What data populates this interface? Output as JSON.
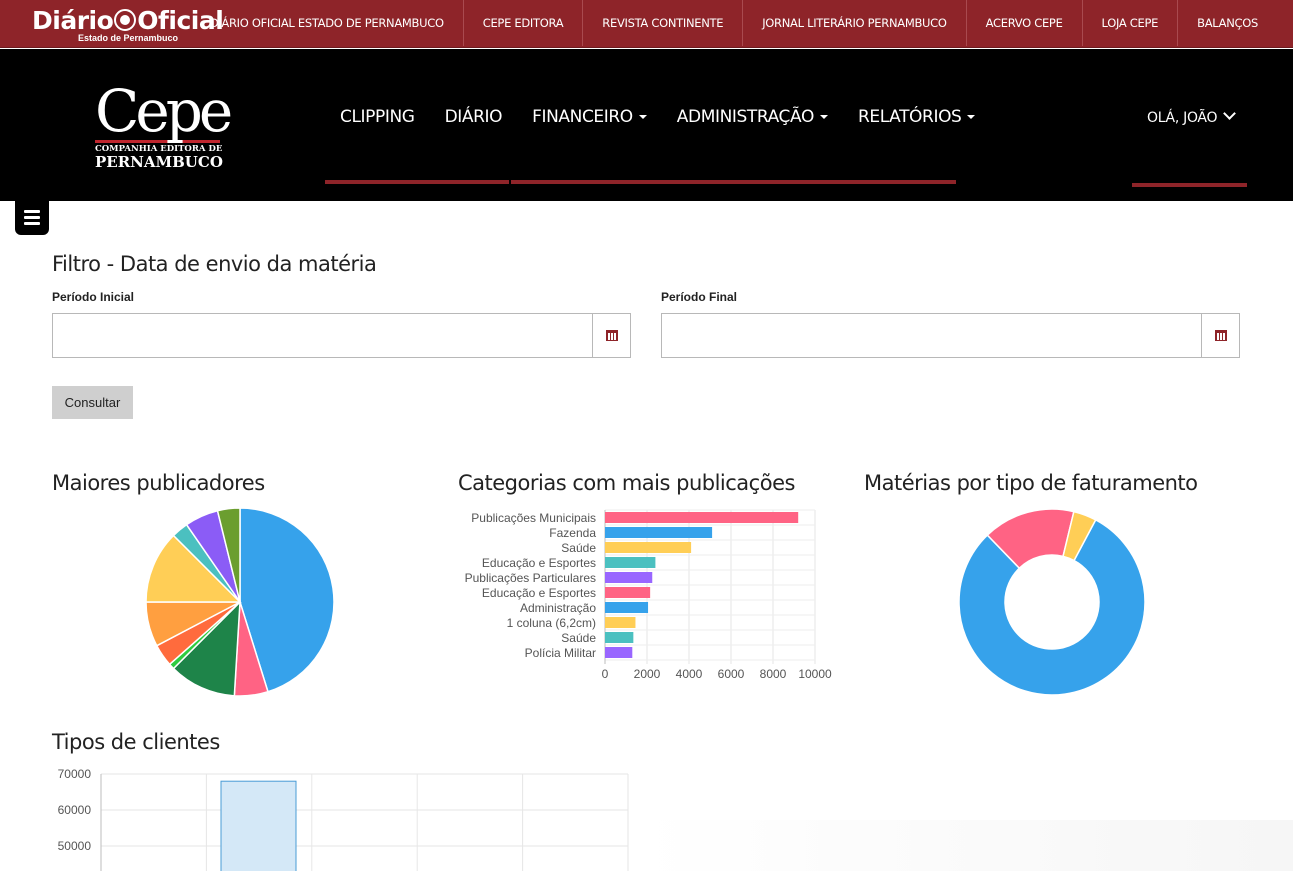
{
  "topbar": {
    "logo_text_1": "Diário",
    "logo_text_2": "Oficial",
    "logo_sub": "Estado de Pernambuco",
    "links": [
      "DIÁRIO OFICIAL ESTADO DE PERNAMBUCO",
      "CEPE EDITORA",
      "REVISTA CONTINENTE",
      "JORNAL LITERÁRIO PERNAMBUCO",
      "ACERVO CEPE",
      "LOJA CEPE",
      "BALANÇOS"
    ]
  },
  "brand": {
    "name": "Cepe",
    "line1": "COMPANHIA EDITORA DE",
    "line2": "PERNAMBUCO"
  },
  "menu": {
    "clipping": "CLIPPING",
    "diario": "DIÁRIO",
    "financeiro": "FINANCEIRO",
    "administracao": "ADMINISTRAÇÃO",
    "relatorios": "RELATÓRIOS",
    "user": "OLÁ, JOÃO"
  },
  "filter": {
    "title": "Filtro - Data de envio da matéria",
    "start_label": "Período Inicial",
    "end_label": "Período Final",
    "start_value": "",
    "end_value": "",
    "submit": "Consultar"
  },
  "colors": {
    "brand_red": "#8e2429",
    "pink": "#ff6384",
    "blue": "#36a2eb",
    "yellow": "#ffce56",
    "teal": "#4bc0c0",
    "purple": "#9966ff",
    "orange": "#ff9f40"
  },
  "headings": {
    "publishers": "Maiores publicadores",
    "categories": "Categorias com mais publicações",
    "billing": "Matérias por tipo de faturamento",
    "clients": "Tipos de clientes"
  },
  "chart_data": [
    {
      "type": "pie",
      "title": "Maiores publicadores",
      "values": [
        47,
        6,
        12,
        1,
        4,
        8,
        13,
        3,
        6,
        4
      ],
      "colors": [
        "#36a2eb",
        "#ff6384",
        "#1e8449",
        "#2ecc40",
        "#ff6b3d",
        "#ff9f40",
        "#ffce56",
        "#4bc0c0",
        "#8b5cf6",
        "#6b9e2f"
      ]
    },
    {
      "type": "bar",
      "orientation": "horizontal",
      "title": "Categorias com mais publicações",
      "categories": [
        "Publicações Municipais",
        "Fazenda",
        "Saúde",
        "Educação e Esportes",
        "Publicações Particulares",
        "Educação e Esportes",
        "Administração",
        "1 coluna (6,2cm)",
        "Saúde",
        "Polícia Militar"
      ],
      "values": [
        9200,
        5100,
        4100,
        2400,
        2250,
        2150,
        2050,
        1450,
        1350,
        1300
      ],
      "colors": [
        "#ff6384",
        "#36a2eb",
        "#ffce56",
        "#4bc0c0",
        "#9966ff",
        "#ff6384",
        "#36a2eb",
        "#ffce56",
        "#4bc0c0",
        "#9966ff"
      ],
      "xticks": [
        "0",
        "2000",
        "4000",
        "6000",
        "8000",
        "10000"
      ],
      "xlim": [
        0,
        10000
      ]
    },
    {
      "type": "pie",
      "variant": "doughnut",
      "title": "Matérias por tipo de faturamento",
      "values": [
        80,
        16,
        4
      ],
      "colors": [
        "#36a2eb",
        "#ff6384",
        "#ffce56"
      ]
    },
    {
      "type": "bar",
      "title": "Tipos de clientes",
      "values": [
        68000
      ],
      "yticks": [
        "70000",
        "60000",
        "50000"
      ],
      "ylim": [
        46000,
        70000
      ],
      "color": "#d4e8f7",
      "border": "#4a9cd6"
    }
  ]
}
